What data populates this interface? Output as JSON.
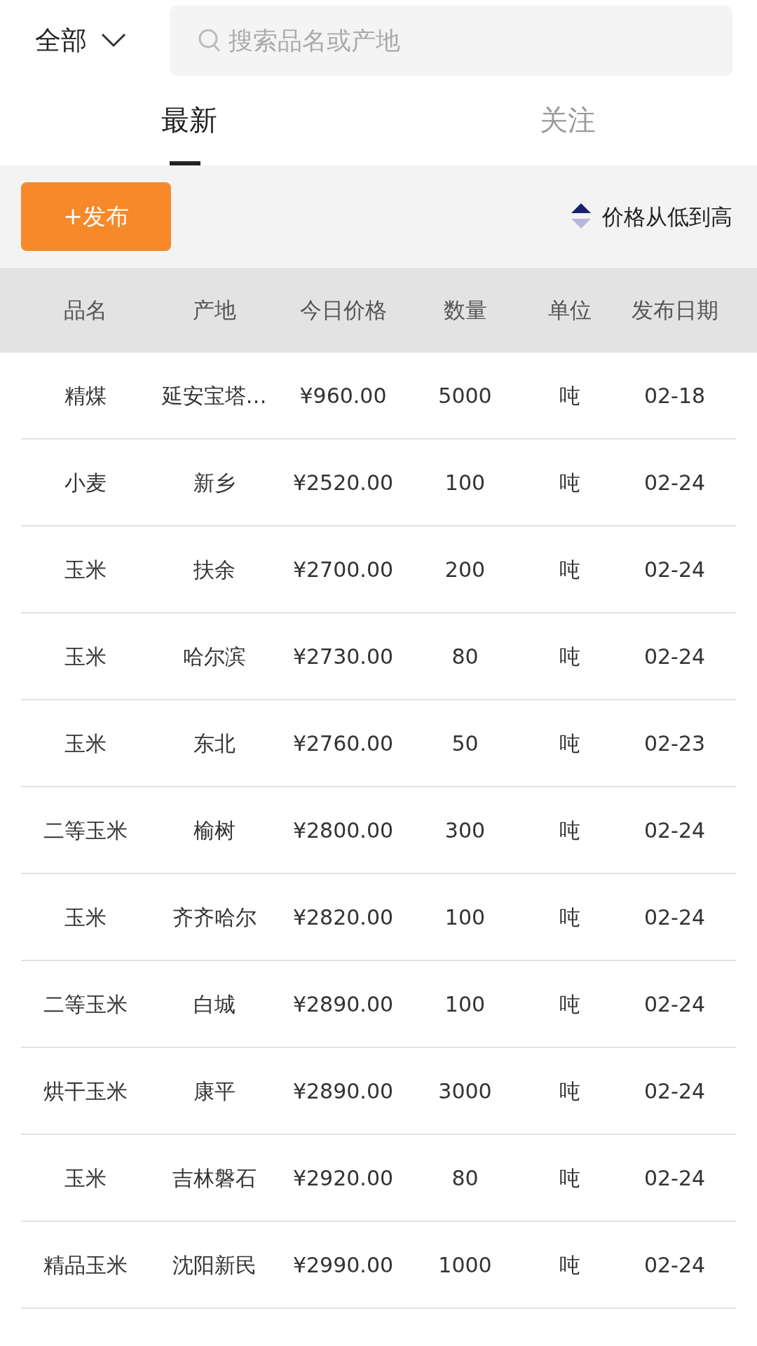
{
  "filter": {
    "label": "全部"
  },
  "search": {
    "placeholder": "搜索品名或产地"
  },
  "tabs": [
    {
      "label": "最新",
      "selected": true
    },
    {
      "label": "关注",
      "selected": false
    }
  ],
  "publish_button": "+发布",
  "sort": {
    "label": "价格从低到高",
    "ascending": true
  },
  "table": {
    "columns": [
      "品名",
      "产地",
      "今日价格",
      "数量",
      "单位",
      "发布日期"
    ],
    "rows": [
      [
        "精煤",
        "延安宝塔…",
        "¥960.00",
        "5000",
        "吨",
        "02-18"
      ],
      [
        "小麦",
        "新乡",
        "¥2520.00",
        "100",
        "吨",
        "02-24"
      ],
      [
        "玉米",
        "扶余",
        "¥2700.00",
        "200",
        "吨",
        "02-24"
      ],
      [
        "玉米",
        "哈尔滨",
        "¥2730.00",
        "80",
        "吨",
        "02-24"
      ],
      [
        "玉米",
        "东北",
        "¥2760.00",
        "50",
        "吨",
        "02-23"
      ],
      [
        "二等玉米",
        "榆树",
        "¥2800.00",
        "300",
        "吨",
        "02-24"
      ],
      [
        "玉米",
        "齐齐哈尔",
        "¥2820.00",
        "100",
        "吨",
        "02-24"
      ],
      [
        "二等玉米",
        "白城",
        "¥2890.00",
        "100",
        "吨",
        "02-24"
      ],
      [
        "烘干玉米",
        "康平",
        "¥2890.00",
        "3000",
        "吨",
        "02-24"
      ],
      [
        "玉米",
        "吉林磐石",
        "¥2920.00",
        "80",
        "吨",
        "02-24"
      ],
      [
        "精品玉米",
        "沈阳新民",
        "¥2990.00",
        "1000",
        "吨",
        "02-24"
      ]
    ]
  }
}
